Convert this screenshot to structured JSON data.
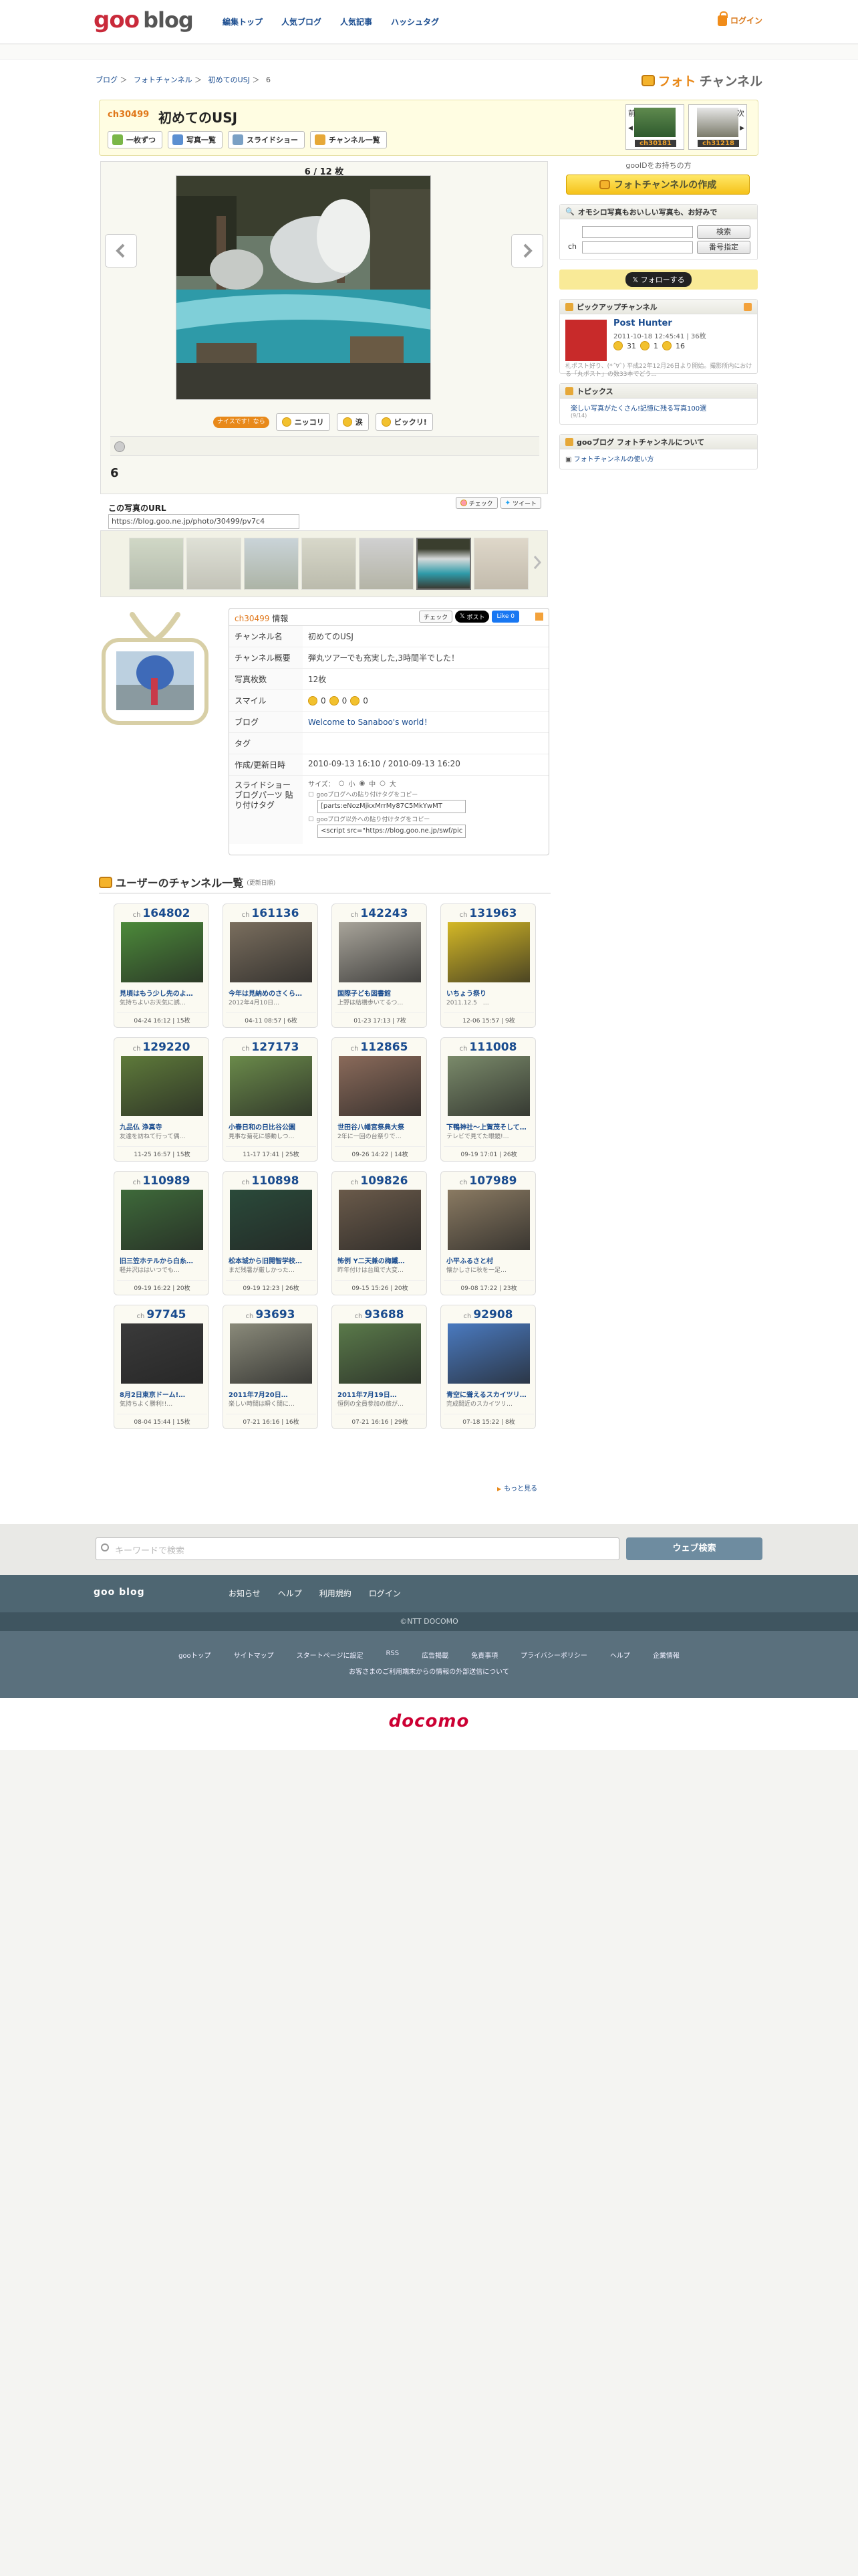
{
  "header": {
    "logo_goo": "goo",
    "logo_blog": "blog",
    "nav": [
      "編集トップ",
      "人気ブログ",
      "人気記事",
      "ハッシュタグ"
    ],
    "login": "ログイン"
  },
  "breadcrumb": [
    "ブログ",
    "＞",
    "フォトチャンネル",
    "＞",
    "初めてのUSJ",
    "＞",
    "6"
  ],
  "brand": {
    "accent": "フォト",
    "rest": "チャンネル"
  },
  "channel": {
    "id": "ch30499",
    "title": "初めてのUSJ",
    "buttons": [
      "一枚ずつ",
      "写真一覧",
      "スライドショー",
      "チャンネル一覧"
    ],
    "prev": {
      "side": "前",
      "label": "ch30181"
    },
    "next": {
      "side": "次",
      "label": "ch31218"
    }
  },
  "viewer": {
    "counter": "6 / 12 枚",
    "reaction_label": "ナイスです！なら",
    "reactions": [
      "ニッコリ",
      "涙",
      "ビックリ!"
    ],
    "photo_number": "6"
  },
  "photo_url": {
    "label": "この写真のURL",
    "value": "https://blog.goo.ne.jp/photo/30499/pv7c4",
    "check": "チェック",
    "tweet": "ツイート"
  },
  "sidebar": {
    "gooid": "gooIDをお持ちの方",
    "create": "フォトチャンネルの作成",
    "search_head": "オモシロ写真もおいしい写真も、お好みで",
    "search_btn": "検索",
    "ch_label": "ch",
    "ch_btn": "番号指定",
    "follow": "フォローする",
    "pickup_head": "ピックアップチャンネル",
    "pickup_name": "Post Hunter",
    "pickup_date": "2011-10-18 12:45:41 | 36枚",
    "pickup_counts": [
      "31",
      "1",
      "16"
    ],
    "pickup_desc": "札ポスト好り、(*´∀`) 平成22年12月26日より開始。撮影所内における「丸ポスト」の数33本でどう...",
    "topics_head": "トピックス",
    "topics": [
      "楽しい写真がたくさん!記憶に残る写真100選"
    ],
    "topics_sub": "(9/14)",
    "about_head": "gooブログ フォトチャンネルについて",
    "about_link": "フォトチャンネルの使い方"
  },
  "info": {
    "id": "ch30499",
    "id_suffix": "情報",
    "check": "チェック",
    "post": "ポスト",
    "like": "Like 0",
    "rows": [
      {
        "k": "チャンネル名",
        "v": "初めてのUSJ"
      },
      {
        "k": "チャンネル概要",
        "v": "弾丸ツアーでも充実した,3時間半でした！"
      },
      {
        "k": "写真枚数",
        "v": "12枚"
      },
      {
        "k": "スマイル",
        "v": ""
      },
      {
        "k": "ブログ",
        "v": "Welcome to Sanaboo's world！"
      },
      {
        "k": "タグ",
        "v": ""
      },
      {
        "k": "作成/更新日時",
        "v": "2010-09-13 16:10 / 2010-09-13 16:20"
      }
    ],
    "smiles": [
      "0",
      "0",
      "0"
    ],
    "slideshow_key": "スライドショー ブログパーツ 貼り付けタグ",
    "size_label": "サイズ：",
    "sizes": [
      "小",
      "中",
      "大"
    ],
    "tag1_label": "gooブログへの貼り付けタグをコピー",
    "tag1": "[parts:eNozMjkxMrrMy87C5MkYwMT",
    "tag2_label": "gooブログ以外への貼り付けタグをコピー",
    "tag2": "<script src=\"https://blog.goo.ne.jp/swf/pic"
  },
  "users": {
    "title": "ユーザーのチャンネル一覧",
    "note": "(更新日順)",
    "more": "もっと見る",
    "cards": [
      {
        "id": "164802",
        "title": "見頃はもう少し先のよ…",
        "desc": "気持ちよいお天気に誘…",
        "meta": "04-24 16:12 | 15枚",
        "color": "#4c8a3a"
      },
      {
        "id": "161136",
        "title": "今年は見納めのさくら…",
        "desc": "2012年4月10日…",
        "meta": "04-11 08:57 | 6枚",
        "color": "#7a6e5e"
      },
      {
        "id": "142243",
        "title": "国際子ども図書館",
        "desc": "上野は結構歩いてるつ…",
        "meta": "01-23 17:13 | 7枚",
        "color": "#a8a49a"
      },
      {
        "id": "131963",
        "title": "いちょう祭り",
        "desc": "2011.12.5　…",
        "meta": "12-06 15:57 | 9枚",
        "color": "#d4b826"
      },
      {
        "id": "129220",
        "title": "九品仏 浄真寺",
        "desc": "友達を訪ねて行って偶…",
        "meta": "11-25 16:57 | 15枚",
        "color": "#5e7a3a"
      },
      {
        "id": "127173",
        "title": "小春日和の日比谷公園",
        "desc": "見事な菊花に感動しつ…",
        "meta": "11-17 17:41 | 25枚",
        "color": "#6a8a4a"
      },
      {
        "id": "112865",
        "title": "世田谷八幡宮祭典大祭",
        "desc": "2年に一回の台祭りで…",
        "meta": "09-26 14:22 | 14枚",
        "color": "#8a6a5a"
      },
      {
        "id": "111008",
        "title": "下鴨神社～上賀茂そして…",
        "desc": "テレビで見てた眼鏡!…",
        "meta": "09-19 17:01 | 26枚",
        "color": "#7a8a6a"
      },
      {
        "id": "110989",
        "title": "旧三笠ホテルから白糸…",
        "desc": "軽井沢ははいつでも…",
        "meta": "09-19 16:22 | 20枚",
        "color": "#3e6a3a"
      },
      {
        "id": "110898",
        "title": "松本城から旧開智学校…",
        "desc": "まだ残暑が厳しかった…",
        "meta": "09-19 12:23 | 26枚",
        "color": "#2a4a3a"
      },
      {
        "id": "109826",
        "title": "怖例 Y二天兼の梅鐵…",
        "desc": "昨年付けは台風で大変…",
        "meta": "09-15 15:26 | 20枚",
        "color": "#6a5a4a"
      },
      {
        "id": "107989",
        "title": "小平ふるさと村",
        "desc": "懐かしさに秋を一足…",
        "meta": "09-08 17:22 | 23枚",
        "color": "#8a7a62"
      },
      {
        "id": "97745",
        "title": "8月2日東京ドーム!…",
        "desc": "気持ちよく勝利!!…",
        "meta": "08-04 15:44 | 15枚",
        "color": "#3a3a3a"
      },
      {
        "id": "93693",
        "title": "2011年7月20日…",
        "desc": "楽しい時間は瞬く間に…",
        "meta": "07-21 16:16 | 16枚",
        "color": "#8a8a7a"
      },
      {
        "id": "93688",
        "title": "2011年7月19日…",
        "desc": "恒例の全員参加の旅が…",
        "meta": "07-21 16:16 | 29枚",
        "color": "#5a7a4a"
      },
      {
        "id": "92908",
        "title": "青空に聳えるスカイツリ…",
        "desc": "完成間近のスカイツリ…",
        "meta": "07-18 15:22 | 8枚",
        "color": "#4a7ac0"
      }
    ]
  },
  "search": {
    "placeholder": "キーワードで検索",
    "button": "ウェブ検索"
  },
  "footer": {
    "brand": "goo blog",
    "nav": [
      "お知らせ",
      "ヘルプ",
      "利用規約",
      "ログイン"
    ],
    "copyright": "©NTT DOCOMO",
    "links": [
      "gooトップ",
      "サイトマップ",
      "スタートページに設定",
      "RSS",
      "広告掲載",
      "免責事項",
      "プライバシーポリシー",
      "ヘルプ",
      "企業情報"
    ],
    "note": "お客さまのご利用端末からの情報の外部送信について",
    "docomo": "docomo"
  }
}
